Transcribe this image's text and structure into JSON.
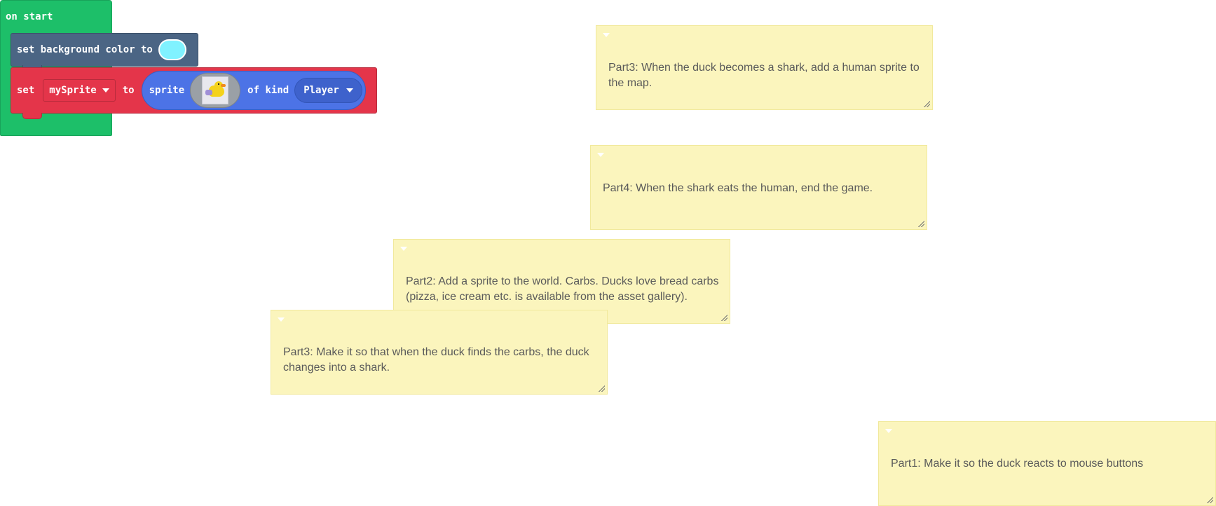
{
  "blocks": {
    "on_start": {
      "label": "on start",
      "color": "#1dbf69"
    },
    "set_background": {
      "label": "set background color to",
      "swatch_color": "#80f2ff",
      "color": "#4b6584"
    },
    "set_sprite": {
      "set_label": "set",
      "variable": "mySprite",
      "to_label": "to",
      "sprite_label": "sprite",
      "kind_label": "of kind",
      "kind_value": "Player",
      "color": "#e4354a",
      "sprite_block_color": "#4c73e6"
    }
  },
  "comments": [
    {
      "id": "c1",
      "text": "Part3: When the duck becomes a shark, add a human sprite to the map."
    },
    {
      "id": "c2",
      "text": "Part4: When the shark eats the human, end the game."
    },
    {
      "id": "c3",
      "text": "Part2: Add a sprite to the world. Carbs. Ducks love bread carbs (pizza, ice cream etc. is available from the asset gallery)."
    },
    {
      "id": "c4",
      "text": "Part3: Make it so that when the duck finds the carbs, the duck changes into a shark."
    },
    {
      "id": "c5",
      "text": "Part1: Make it so the duck reacts to mouse buttons"
    }
  ],
  "comment_color": "#fbf5bd"
}
